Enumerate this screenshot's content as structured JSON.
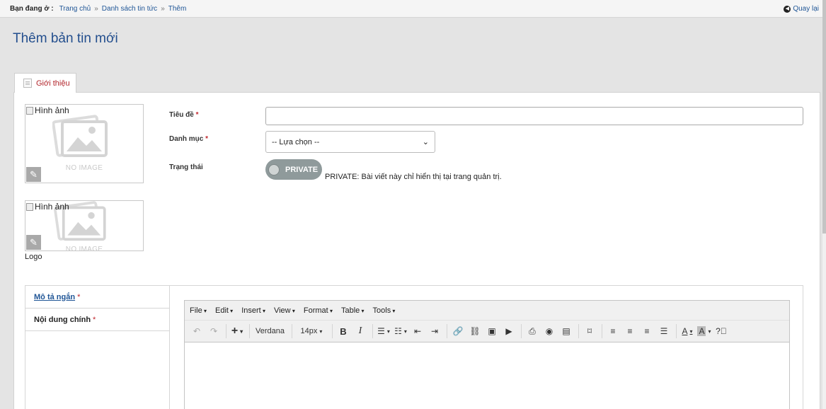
{
  "breadcrumb": {
    "prefix": "Bạn đang ở :",
    "items": [
      "Trang chủ",
      "Danh sách tin tức",
      "Thêm"
    ],
    "separator": "»"
  },
  "back_label": "Quay lại",
  "page_title": "Thêm bản tin mới",
  "tab_label": "Giới thiệu",
  "image": {
    "alt": "Hình ảnh",
    "no_image": "NO IMAGE",
    "logo_caption": "Logo"
  },
  "form": {
    "title_label": "Tiêu đề",
    "category_label": "Danh mục",
    "status_label": "Trạng thái",
    "required_mark": "*",
    "title_value": "",
    "category_selected": "-- Lựa chọn --",
    "status_toggle": "PRIVATE",
    "status_note": "PRIVATE: Bài viết này chỉ hiển thị tại trang quản trị."
  },
  "content_tabs": [
    {
      "label": "Mô tả ngắn",
      "active": true
    },
    {
      "label": "Nội dung chính",
      "active": false
    }
  ],
  "editor": {
    "menus": [
      "File",
      "Edit",
      "Insert",
      "View",
      "Format",
      "Table",
      "Tools"
    ],
    "font_family": "Verdana",
    "font_size": "14px"
  },
  "colors": {
    "title_blue": "#244f8e",
    "link_blue": "#1f5596",
    "required_red": "#c0272d",
    "toggle_gray": "#8f9a9b"
  }
}
